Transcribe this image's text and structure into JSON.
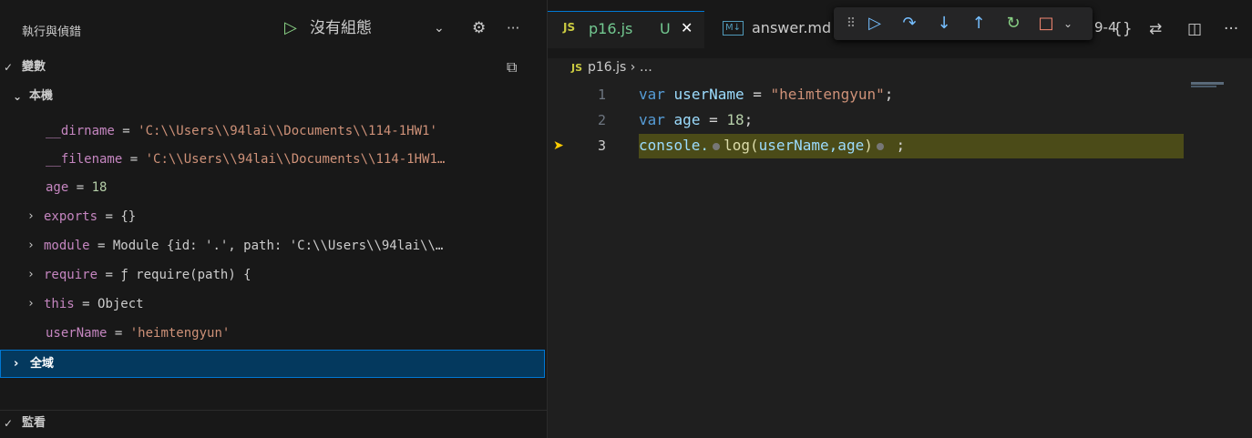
{
  "debug_panel": {
    "title": "執行與偵錯",
    "run_icon": "▷",
    "config_label": "沒有組態",
    "config_chevron": "⌄",
    "gear_icon": "⚙",
    "more_icon": "···"
  },
  "sections": {
    "variables": {
      "chevron": "✓",
      "label": "變數",
      "collapse_icon": "⧉"
    },
    "local": {
      "chevron": "⌄",
      "label": "本機"
    },
    "global": {
      "chevron": "›",
      "label": "全域"
    },
    "watch": {
      "chevron": "✓",
      "label": "監看"
    }
  },
  "variables": [
    {
      "twisty": "",
      "name": "__dirname",
      "eq": " = ",
      "value": "'C:\\\\Users\\\\94lai\\\\Documents\\\\114-1HW1'",
      "kind": "str"
    },
    {
      "twisty": "",
      "name": "__filename",
      "eq": " = ",
      "value": "'C:\\\\Users\\\\94lai\\\\Documents\\\\114-1HW1…",
      "kind": "str"
    },
    {
      "twisty": "",
      "name": "age",
      "eq": " = ",
      "value": "18",
      "kind": "num"
    },
    {
      "twisty": "›",
      "name": "exports",
      "eq": " = ",
      "value": "{}",
      "kind": "obj"
    },
    {
      "twisty": "›",
      "name": "module",
      "eq": " = ",
      "value": "Module {id: '.', path: 'C:\\\\Users\\\\94lai\\\\…",
      "kind": "obj"
    },
    {
      "twisty": "›",
      "name": "require",
      "eq": " = ",
      "value": "ƒ require(path) {",
      "kind": "obj"
    },
    {
      "twisty": "›",
      "name": "this",
      "eq": " = ",
      "value": "Object",
      "kind": "obj"
    },
    {
      "twisty": "",
      "name": "userName",
      "eq": " = ",
      "value": "'heimtengyun'",
      "kind": "str"
    }
  ],
  "tabs": {
    "active": {
      "icon": "JS",
      "name": "p16.js",
      "status": "U",
      "close": "✕"
    },
    "second": {
      "icon": "M↓",
      "name": "answer.md"
    },
    "partial": "9-4"
  },
  "debug_toolbar": {
    "grip": "⠿",
    "continue": "▷",
    "step_over": "↷",
    "step_into": "↓",
    "step_out": "↑",
    "restart": "↻",
    "stop": "□",
    "stop_chevron": "⌄"
  },
  "editor_actions": {
    "braces": "{}",
    "compare": "⇄",
    "split": "◫",
    "more": "···"
  },
  "breadcrumb": {
    "icon": "JS",
    "file": "p16.js",
    "sep": " › …"
  },
  "code": {
    "line1": {
      "num": "1",
      "kw": "var",
      "id": "userName",
      "op": " = ",
      "val": "\"heimtengyun\"",
      "end": ";"
    },
    "line2": {
      "num": "2",
      "kw": "var",
      "id": "age",
      "op": " = ",
      "val": "18",
      "end": ";"
    },
    "line3": {
      "num": "3",
      "obj": "console.",
      "fn": "log",
      "open": "(",
      "args": "userName,age",
      "close": ")",
      "end": " ;"
    }
  },
  "breakpoint_icon": "➤",
  "colors": {
    "accent": "#0078d4",
    "current_line": "#4b4b18",
    "breakpoint": "#ffcc00",
    "modified": "#73c991"
  }
}
